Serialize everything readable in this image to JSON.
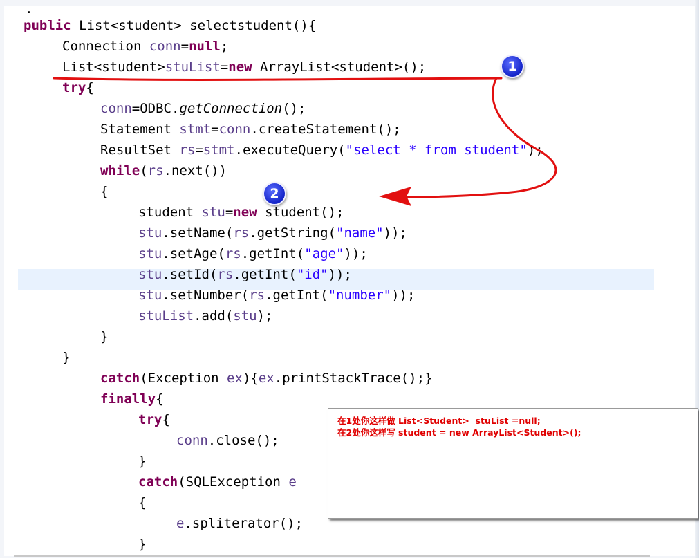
{
  "code_lines": {
    "l0": {
      "tok0": "."
    },
    "l1": {
      "tok0": "public",
      "tok1": " List<student> selectstudent(){"
    },
    "l2": {
      "tok0": "Connection ",
      "tok1": "conn",
      "tok2": "=",
      "tok3": "null",
      "tok4": ";"
    },
    "l3": {
      "tok0": "List<student>",
      "tok1": "stuList",
      "tok2": "=",
      "tok3": "new",
      "tok4": " ArrayList<student>();"
    },
    "l4": {
      "tok0": "try",
      "tok1": "{"
    },
    "l5": {
      "tok0": "conn",
      "tok1": "=ODBC.",
      "tok2": "getConnection",
      "tok3": "();"
    },
    "l6": {
      "tok0": "Statement ",
      "tok1": "stmt",
      "tok2": "=",
      "tok3": "conn",
      "tok4": ".createStatement();"
    },
    "l7": {
      "tok0": "ResultSet ",
      "tok1": "rs",
      "tok2": "=",
      "tok3": "stmt",
      "tok4": ".executeQuery(",
      "tok5": "\"select * from student\"",
      "tok6": ");"
    },
    "l8": {
      "tok0": "while",
      "tok1": "(",
      "tok2": "rs",
      "tok3": ".next())"
    },
    "l9": {
      "tok0": "{"
    },
    "l10": {
      "tok0": "student ",
      "tok1": "stu",
      "tok2": "=",
      "tok3": "new",
      "tok4": " student();"
    },
    "l11": {
      "tok0": "stu",
      "tok1": ".setName(",
      "tok2": "rs",
      "tok3": ".getString(",
      "tok4": "\"name\"",
      "tok5": "));"
    },
    "l12": {
      "tok0": "stu",
      "tok1": ".setAge(",
      "tok2": "rs",
      "tok3": ".getInt(",
      "tok4": "\"age\"",
      "tok5": "));"
    },
    "l13": {
      "tok0": "stu",
      "tok1": ".setId(",
      "tok2": "rs",
      "tok3": ".getInt(",
      "tok4": "\"id\"",
      "tok5": "));"
    },
    "l14": {
      "tok0": "stu",
      "tok1": ".setNumber(",
      "tok2": "rs",
      "tok3": ".getInt(",
      "tok4": "\"number\"",
      "tok5": "));"
    },
    "l15": {
      "tok0": "stuList",
      "tok1": ".add(",
      "tok2": "stu",
      "tok3": ");"
    },
    "l16": {
      "tok0": "}"
    },
    "l17": {
      "tok0": "}"
    },
    "l18": {
      "tok0": "catch",
      "tok1": "(Exception ",
      "tok2": "ex",
      "tok3": "){",
      "tok4": "ex",
      "tok5": ".printStackTrace();}"
    },
    "l19": {
      "tok0": "finally",
      "tok1": "{"
    },
    "l20": {
      "tok0": "try",
      "tok1": "{"
    },
    "l21": {
      "tok0": "conn",
      "tok1": ".close();"
    },
    "l22": {
      "tok0": "}"
    },
    "l23": {
      "tok0": "catch",
      "tok1": "(SQLException ",
      "tok2": "e"
    },
    "l24": {
      "tok0": "{"
    },
    "l25": {
      "tok0": "e",
      "tok1": ".spliterator();"
    },
    "l26": {
      "tok0": "}"
    }
  },
  "note": {
    "line1": "在1处你这样做 List<Student>  stuList =null;",
    "line2": "在2处你这样写 student = new ArrayList<Student>();"
  },
  "markers": {
    "m1": "1",
    "m2": "2"
  },
  "colors": {
    "keyword": "#7f0055",
    "string": "#2a00ff",
    "variable": "#5a3e8a",
    "annotation_red": "#e00000",
    "marker_blue": "#1424c8",
    "highlight": "#e8f2fe"
  }
}
